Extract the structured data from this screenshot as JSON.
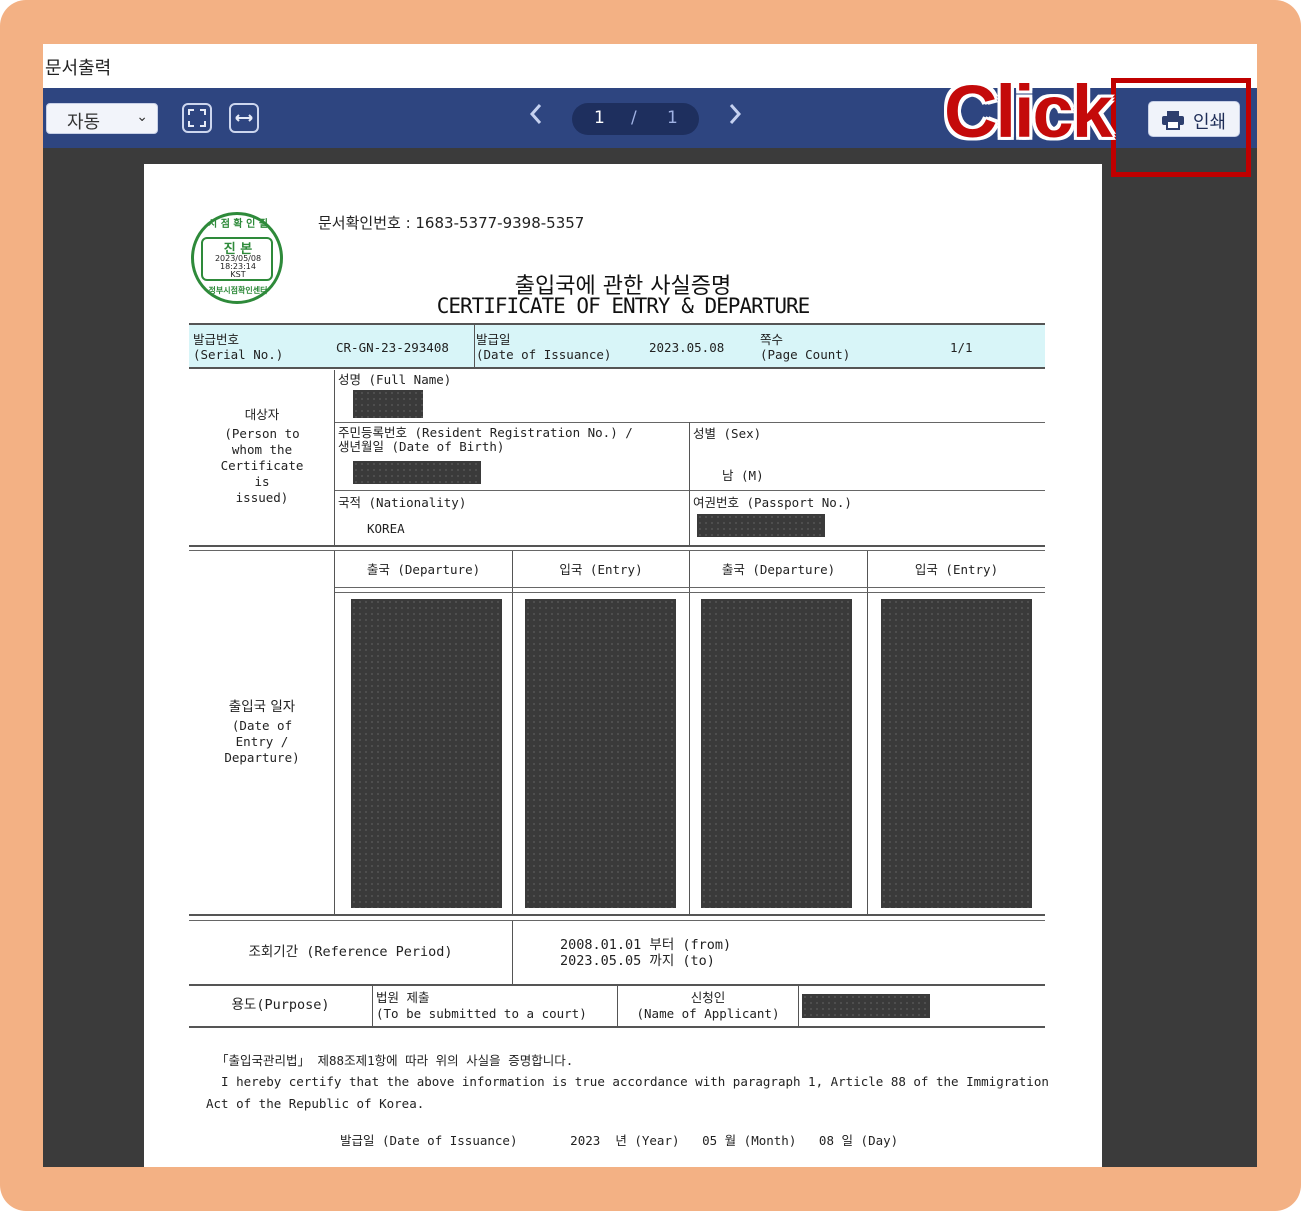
{
  "window": {
    "title": "문서출력"
  },
  "toolbar": {
    "zoom_value": "자동",
    "zoom_caret": "⌄",
    "page_current": "1",
    "page_sep": "/",
    "page_total": "1",
    "prev_icon": "‹",
    "next_icon": "›",
    "print_label": "인쇄"
  },
  "annotation": {
    "click_text": "Click",
    "accent": "#c00000"
  },
  "document": {
    "doc_number": "문서확인번호 :  1683-5377-9398-5357",
    "title_ko": "출입국에 관한 사실증명",
    "title_en": "CERTIFICATE OF ENTRY & DEPARTURE",
    "stamp": {
      "top": "시 점 확 인 필",
      "center": "진 본",
      "date": "2023/05/08",
      "time": "18:23:14",
      "tz": "KST",
      "bottom": "정부시점확인센터"
    },
    "serial_label_ko": "발급번호",
    "serial_label_en": "(Serial No.)",
    "serial_value": "CR-GN-23-293408",
    "issue_label_ko": "발급일",
    "issue_label_en": "(Date of Issuance)",
    "issue_value": "2023.05.08",
    "pages_label_ko": "쪽수",
    "pages_label_en": "(Page Count)",
    "pages_value": "1/1",
    "subject_label_ko": "대상자",
    "subject_label_en": "(Person to\nwhom the\nCertificate\nis\nissued)",
    "fullname_label": "성명 (Full Name)",
    "rrn_label": "주민등록번호 (Resident Registration No.) /\n생년월일 (Date of Birth)",
    "sex_label": "성별 (Sex)",
    "sex_value": "남 (M)",
    "nationality_label": "국적 (Nationality)",
    "nationality_value": "KOREA",
    "passport_label": "여권번호 (Passport No.)",
    "dates_label_ko": "출입국 일자",
    "dates_label_en": "(Date of\nEntry /\nDeparture)",
    "col_headers": [
      "출국 (Departure)",
      "입국 (Entry)",
      "출국 (Departure)",
      "입국 (Entry)"
    ],
    "period_label": "조회기간 (Reference Period)",
    "period_value": "2008.01.01 부터 (from)\n2023.05.05 까지 (to)",
    "purpose_label": "용도(Purpose)",
    "purpose_value": "법원 제출\n(To be submitted to a court)",
    "applicant_label": "신청인\n(Name of Applicant)",
    "cert_line1": "「출입국관리법」 제88조제1항에 따라 위의 사실을 증명합니다.",
    "cert_line2": "  I hereby certify that the above information is true accordance with paragraph 1, Article 88 of the Immigration",
    "cert_line3": "Act of the Republic of Korea.",
    "issue_footer": "발급일 (Date of Issuance)       2023  년 (Year)   05 월 (Month)   08 일 (Day)"
  },
  "colors": {
    "toolbar": "#2e4580",
    "viewer_bg": "#3b3b3b",
    "header_row": "#d8f5f8",
    "frame": "#f3b184"
  }
}
